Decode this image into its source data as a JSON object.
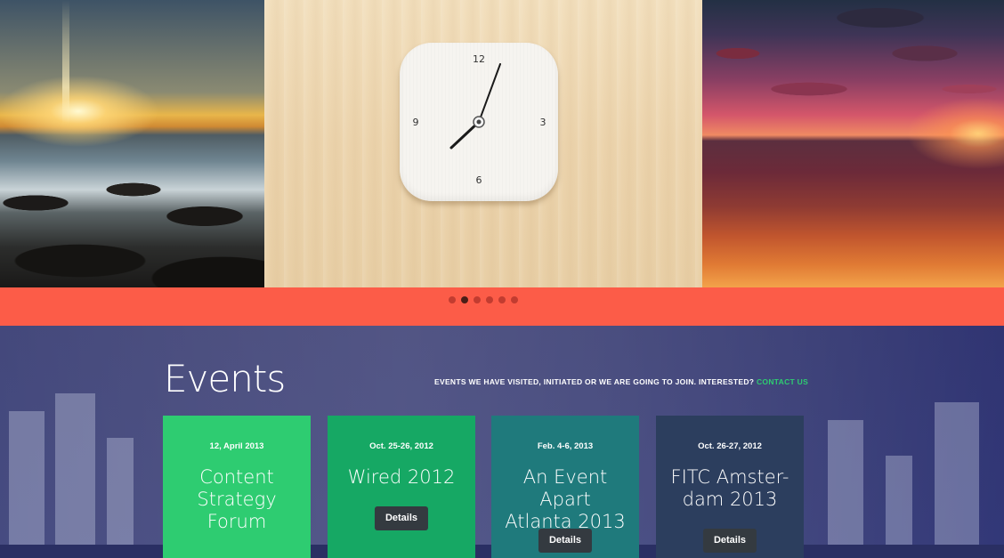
{
  "gallery": {
    "clock": {
      "n12": "12",
      "n3": "3",
      "n6": "6",
      "n9": "9"
    },
    "pager": {
      "count": 6,
      "active_index": 1
    }
  },
  "events": {
    "title": "Events",
    "tagline": "EVENTS WE HAVE VISITED, INITIATED OR WE ARE GOING TO JOIN. INTERESTED?",
    "contact_link": "CONTACT US",
    "cards": [
      {
        "date": "12, April 2013",
        "title_line1": "Content",
        "title_line2": "Strategy",
        "title_line3": "Forum",
        "color": "#2ecc71"
      },
      {
        "date": "Oct. 25-26, 2012",
        "title_line1": "Wired 2012",
        "button": "Details",
        "color": "#16a864"
      },
      {
        "date": "Feb. 4-6, 2013",
        "title_line1": "An Event Apart",
        "title_line2": "Atlanta 2013",
        "button": "Details",
        "color": "#1f7a7c"
      },
      {
        "date": "Oct. 26-27, 2012",
        "title_line1": "FITC Amster-",
        "title_line2": "dam 2013",
        "button": "Details",
        "color": "#2c3e5e"
      }
    ]
  }
}
